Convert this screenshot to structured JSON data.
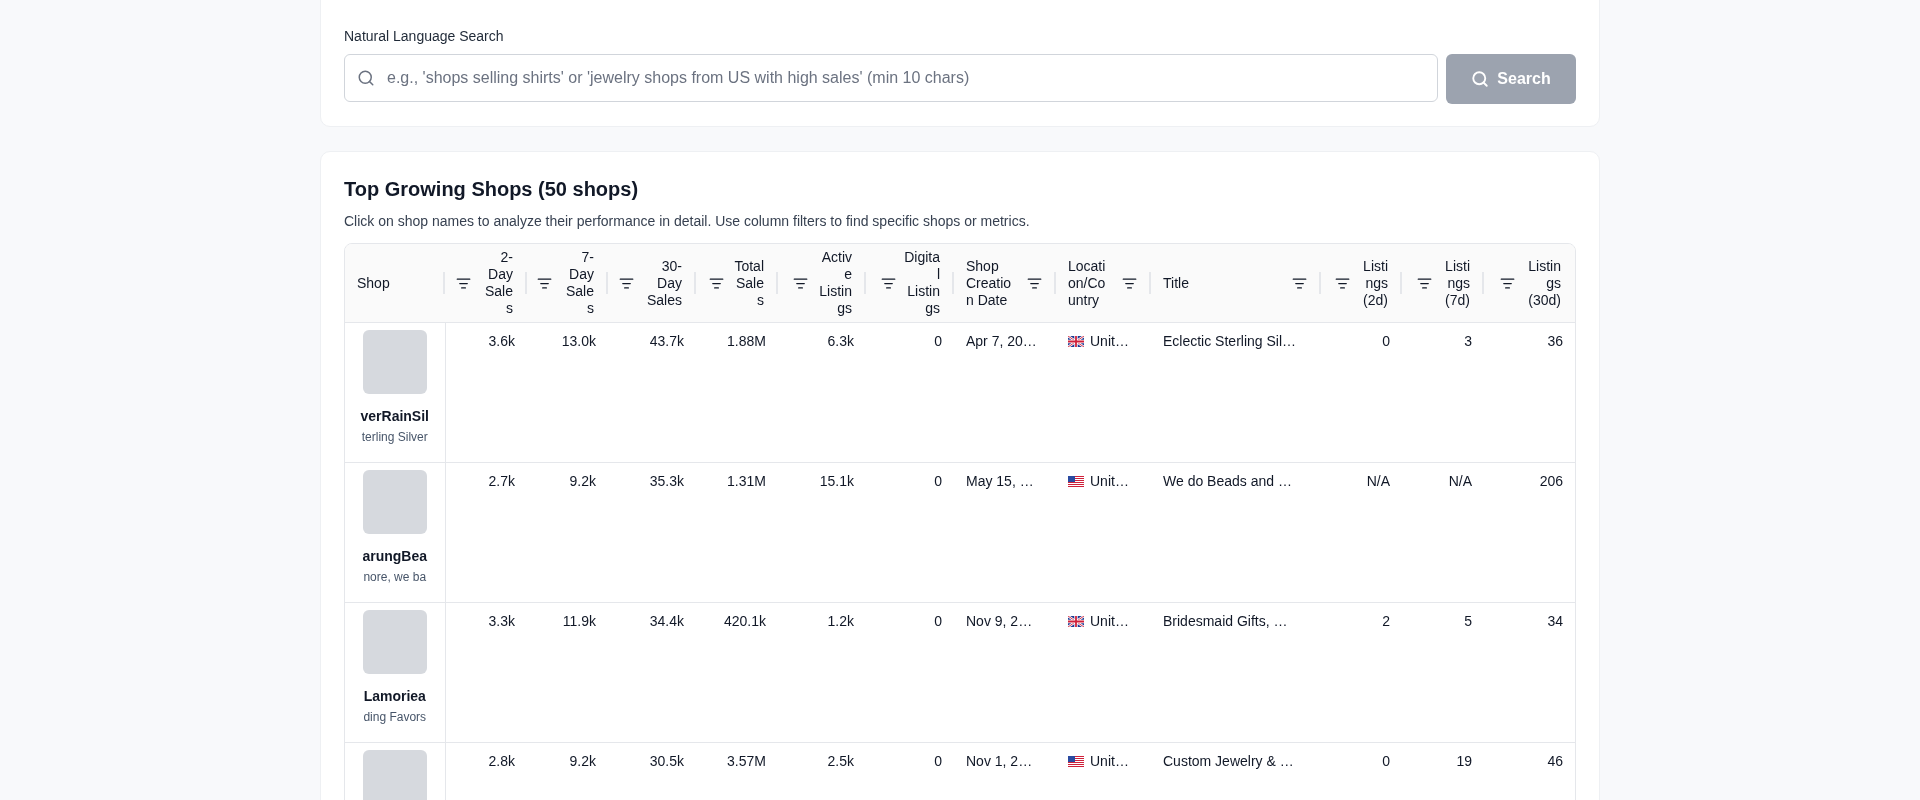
{
  "search": {
    "label": "Natural Language Search",
    "placeholder": "e.g., 'shops selling shirts' or 'jewelry shops from US with high sales' (min 10 chars)",
    "button": {
      "label": "Search",
      "disabled": true
    }
  },
  "shops_table": {
    "title": "Top Growing Shops (50 shops)",
    "description": "Click on shop names to analyze their performance in detail. Use column filters to find specific shops or metrics.",
    "columns": [
      {
        "label": "Shop",
        "kind": "shop"
      },
      {
        "label": "2-Day Sales",
        "kind": "numeric"
      },
      {
        "label": "7-Day Sales",
        "kind": "numeric"
      },
      {
        "label": "30-Day Sales",
        "kind": "numeric"
      },
      {
        "label": "Total Sales",
        "kind": "numeric"
      },
      {
        "label": "Active Listings",
        "kind": "numeric"
      },
      {
        "label": "Digital Listings",
        "kind": "numeric"
      },
      {
        "label": "Shop Creation Date",
        "kind": "text"
      },
      {
        "label": "Location/Country",
        "kind": "text"
      },
      {
        "label": "Title",
        "kind": "text"
      },
      {
        "label": "Listings (2d)",
        "kind": "numeric"
      },
      {
        "label": "Listings (7d)",
        "kind": "numeric"
      },
      {
        "label": "Listings (30d)",
        "kind": "numeric"
      }
    ],
    "rows": [
      {
        "cells": [
          {
            "name": "verRainSil",
            "tagline": "terling Silver"
          },
          "3.6k",
          "13.0k",
          "43.7k",
          "1.88M",
          "6.3k",
          "0",
          "Apr 7, 20…",
          {
            "kind": "uk",
            "text": "Unit…"
          },
          "Eclectic Sterling Sil…",
          "0",
          "3",
          "36"
        ]
      },
      {
        "cells": [
          {
            "name": "arungBea",
            "tagline": "nore, we ba"
          },
          "2.7k",
          "9.2k",
          "35.3k",
          "1.31M",
          "15.1k",
          "0",
          "May 15, …",
          {
            "kind": "us",
            "text": "Unit…"
          },
          "We do Beads and …",
          "N/A",
          "N/A",
          "206"
        ]
      },
      {
        "cells": [
          {
            "name": "Lamoriea",
            "tagline": "ding Favors"
          },
          "3.3k",
          "11.9k",
          "34.4k",
          "420.1k",
          "1.2k",
          "0",
          "Nov 9, 2…",
          {
            "kind": "uk",
            "text": "Unit…"
          },
          "Bridesmaid Gifts, …",
          "2",
          "5",
          "34"
        ]
      },
      {
        "cells": [
          {},
          "2.8k",
          "9.2k",
          "30.5k",
          "3.57M",
          "2.5k",
          "0",
          "Nov 1, 2…",
          {
            "kind": "us",
            "text": "Unit…"
          },
          "Custom Jewelry & …",
          "0",
          "19",
          "46"
        ]
      }
    ]
  }
}
